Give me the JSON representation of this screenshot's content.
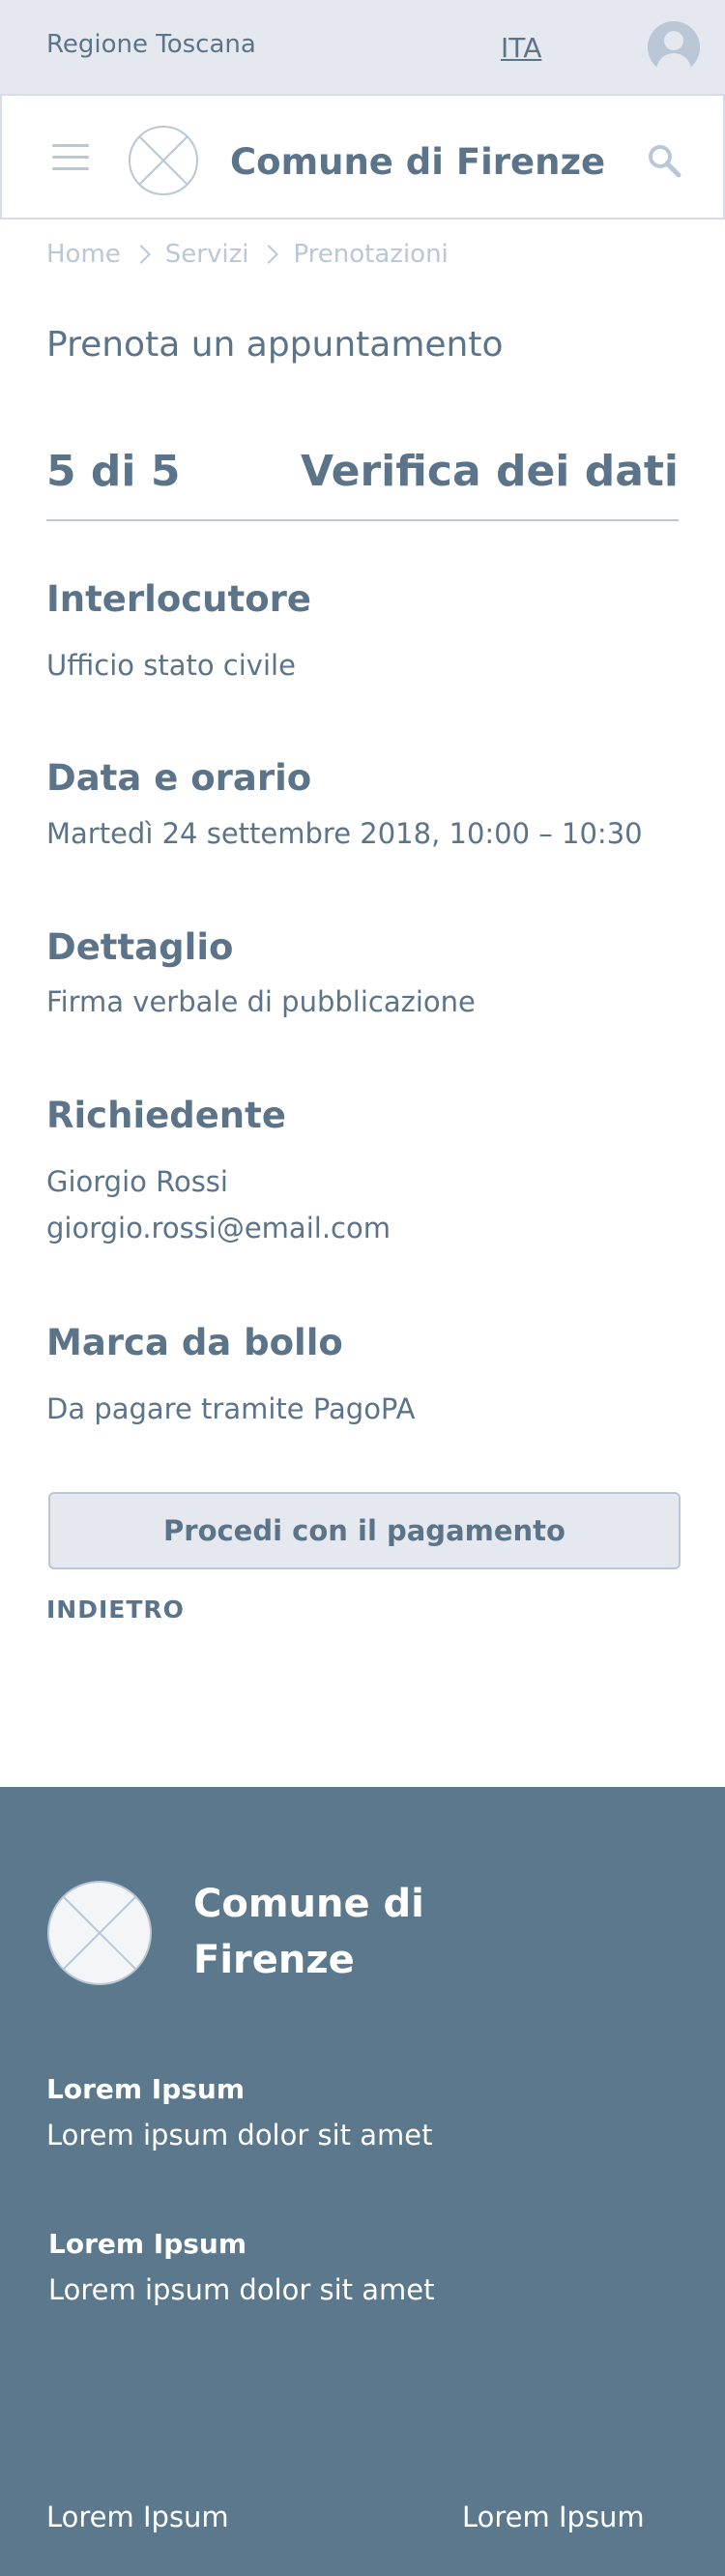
{
  "region": {
    "name": "Regione Toscana",
    "language": "ITA"
  },
  "header": {
    "title": "Comune di Firenze"
  },
  "breadcrumb": [
    "Home",
    "Servizi",
    "Prenotazioni"
  ],
  "page": {
    "title": "Prenota un appuntamento",
    "step": "5 di 5",
    "step_title": "Verifica dei dati"
  },
  "summary": {
    "interlocutor": {
      "title": "Interlocutore",
      "value": "Ufficio stato civile"
    },
    "datetime": {
      "title": "Data e orario",
      "value": "Martedì 24 settembre 2018, 10:00 – 10:30"
    },
    "detail": {
      "title": "Dettaglio",
      "value": "Firma verbale di pubblicazione"
    },
    "applicant": {
      "title": "Richiedente",
      "name": "Giorgio Rossi",
      "email": "giorgio.rossi@email.com"
    },
    "stamp": {
      "title": "Marca da bollo",
      "value": "Da pagare tramite PagoPA"
    }
  },
  "actions": {
    "pay": "Procedi con il pagamento",
    "back": "INDIETRO"
  },
  "footer": {
    "title": "Comune di Firenze",
    "blocks": [
      {
        "heading": "Lorem Ipsum",
        "text": "Lorem ipsum dolor sit amet"
      },
      {
        "heading": "Lorem Ipsum",
        "text": "Lorem ipsum dolor sit amet"
      }
    ],
    "links": [
      "Lorem Ipsum",
      "Lorem Ipsum"
    ]
  },
  "colors": {
    "primary": "#5c7489",
    "light": "#b9c7d6",
    "background_light": "#e5e9ef",
    "footer": "#5c788c"
  }
}
